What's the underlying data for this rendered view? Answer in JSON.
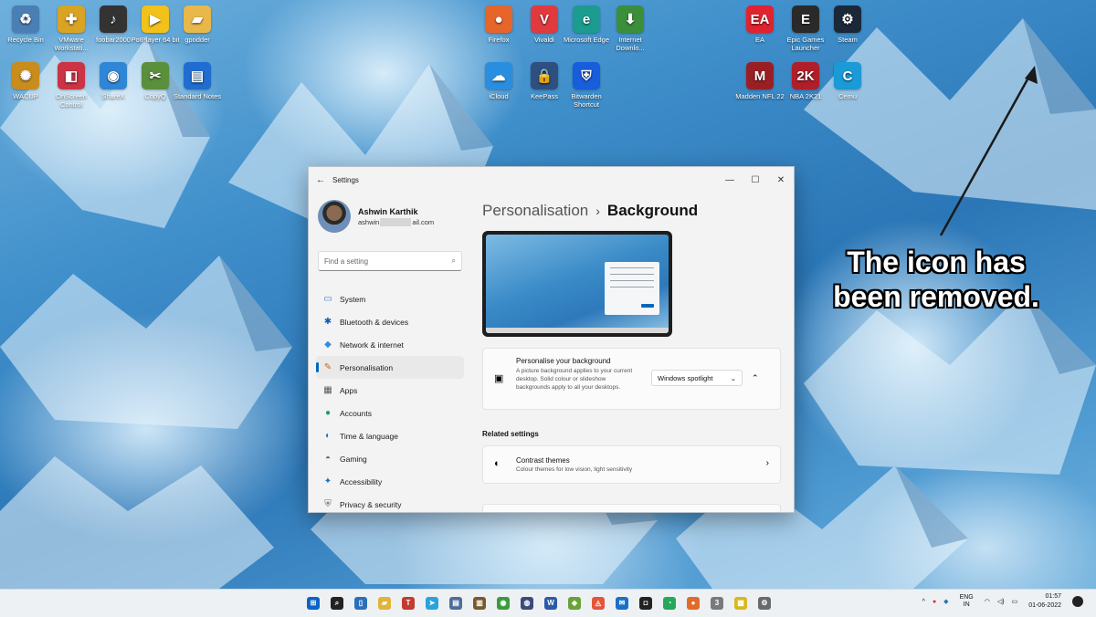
{
  "desktop": {
    "icons": [
      {
        "label": "Recycle Bin",
        "icon": "recycle-bin-icon",
        "color": "#4a7fb5",
        "glyph": "♻"
      },
      {
        "label": "VMware Workstati...",
        "icon": "vmware-icon",
        "color": "#d9a323",
        "glyph": "✚"
      },
      {
        "label": "foobar2000",
        "icon": "foobar-icon",
        "color": "#333333",
        "glyph": "♪"
      },
      {
        "label": "PotPlayer 64 bit",
        "icon": "potplayer-icon",
        "color": "#f2c21b",
        "glyph": "▶"
      },
      {
        "label": "gpodder",
        "icon": "folder-icon",
        "color": "#e8b84a",
        "glyph": "▰"
      },
      {
        "label": "WACUP",
        "icon": "wacup-icon",
        "color": "#c98d1d",
        "glyph": "✺"
      },
      {
        "label": "OnScreen Control",
        "icon": "onscreen-control-icon",
        "color": "#cc3344",
        "glyph": "◧"
      },
      {
        "label": "ShareX",
        "icon": "sharex-icon",
        "color": "#2f86d6",
        "glyph": "◉"
      },
      {
        "label": "CopyQ",
        "icon": "copyq-icon",
        "color": "#5a8f3c",
        "glyph": "✂"
      },
      {
        "label": "Standard Notes",
        "icon": "standard-notes-icon",
        "color": "#1f6dd0",
        "glyph": "▤"
      },
      {
        "label": "Firefox",
        "icon": "firefox-icon",
        "color": "#e5652b",
        "glyph": "●"
      },
      {
        "label": "Vivaldi",
        "icon": "vivaldi-icon",
        "color": "#e0393e",
        "glyph": "V"
      },
      {
        "label": "Microsoft Edge",
        "icon": "edge-icon",
        "color": "#1b9c8e",
        "glyph": "e"
      },
      {
        "label": "Internet Downlo...",
        "icon": "idm-icon",
        "color": "#3b8f3b",
        "glyph": "⬇"
      },
      {
        "label": "iCloud",
        "icon": "icloud-icon",
        "color": "#2a8ee0",
        "glyph": "☁"
      },
      {
        "label": "KeePass",
        "icon": "keepass-icon",
        "color": "#2f4f7f",
        "glyph": "🔒"
      },
      {
        "label": "Bitwarden Shortcut",
        "icon": "bitwarden-icon",
        "color": "#175ddc",
        "glyph": "⛨"
      },
      {
        "label": "EA",
        "icon": "ea-icon",
        "color": "#e0232f",
        "glyph": "EA"
      },
      {
        "label": "Epic Games Launcher",
        "icon": "epic-games-icon",
        "color": "#2a2a2a",
        "glyph": "E"
      },
      {
        "label": "Steam",
        "icon": "steam-icon",
        "color": "#1b2838",
        "glyph": "⚙"
      },
      {
        "label": "Madden NFL 22",
        "icon": "madden-icon",
        "color": "#9a1f24",
        "glyph": "M"
      },
      {
        "label": "NBA 2K21",
        "icon": "nba2k21-icon",
        "color": "#b01e2a",
        "glyph": "2K"
      },
      {
        "label": "Cemu",
        "icon": "cemu-icon",
        "color": "#1a9ad6",
        "glyph": "C"
      }
    ]
  },
  "annotation": {
    "line1": "The icon has",
    "line2": "been removed."
  },
  "window": {
    "title": "Settings",
    "back_glyph": "←",
    "minimize_glyph": "—",
    "maximize_glyph": "☐",
    "close_glyph": "✕",
    "profile": {
      "name": "Ashwin Karthik",
      "email_start": "ashwin",
      "email_end": "ail.com"
    },
    "search": {
      "placeholder": "Find a setting"
    },
    "nav": [
      {
        "label": "System",
        "icon": "system-icon",
        "glyph": "▭",
        "color": "#3b7fd1",
        "active": false
      },
      {
        "label": "Bluetooth & devices",
        "icon": "bluetooth-icon",
        "glyph": "✱",
        "color": "#0a5ec2",
        "active": false
      },
      {
        "label": "Network & internet",
        "icon": "network-icon",
        "glyph": "◆",
        "color": "#2d8fe0",
        "active": false
      },
      {
        "label": "Personalisation",
        "icon": "brush-icon",
        "glyph": "✎",
        "color": "#c56a1a",
        "active": true
      },
      {
        "label": "Apps",
        "icon": "apps-icon",
        "glyph": "▦",
        "color": "#555555",
        "active": false
      },
      {
        "label": "Accounts",
        "icon": "accounts-icon",
        "glyph": "●",
        "color": "#1f9c6b",
        "active": false
      },
      {
        "label": "Time & language",
        "icon": "time-language-icon",
        "glyph": "◐",
        "color": "#2277cc",
        "active": false
      },
      {
        "label": "Gaming",
        "icon": "gaming-icon",
        "glyph": "◓",
        "color": "#666666",
        "active": false
      },
      {
        "label": "Accessibility",
        "icon": "accessibility-icon",
        "glyph": "✦",
        "color": "#1a6fc4",
        "active": false
      },
      {
        "label": "Privacy & security",
        "icon": "shield-icon",
        "glyph": "⛨",
        "color": "#666666",
        "active": false
      }
    ],
    "breadcrumb": {
      "parent": "Personalisation",
      "separator": "›",
      "current": "Background"
    },
    "background_card": {
      "title": "Personalise your background",
      "description": "A picture background applies to your current desktop. Solid colour or slideshow backgrounds apply to all your desktops.",
      "dropdown_value": "Windows spotlight",
      "expand_glyph": "⌃"
    },
    "related_heading": "Related settings",
    "contrast_card": {
      "title": "Contrast themes",
      "description": "Colour themes for low vision, light sensitivity"
    }
  },
  "taskbar": {
    "apps": [
      {
        "icon": "start-icon",
        "glyph": "⊞",
        "color": "#0a64c8"
      },
      {
        "icon": "search-icon",
        "glyph": "⌕",
        "color": "#222222"
      },
      {
        "icon": "phone-icon",
        "glyph": "▯",
        "color": "#2b6fb8"
      },
      {
        "icon": "file-explorer-icon",
        "glyph": "▰",
        "color": "#e2b33a"
      },
      {
        "icon": "app-t-icon",
        "glyph": "T",
        "color": "#c33a2f"
      },
      {
        "icon": "telegram-icon",
        "glyph": "➤",
        "color": "#2aa3dc"
      },
      {
        "icon": "calendar-icon",
        "glyph": "▤",
        "color": "#4d6e9a"
      },
      {
        "icon": "book-icon",
        "glyph": "▥",
        "color": "#7a5a2c"
      },
      {
        "icon": "chrome-icon",
        "glyph": "◉",
        "color": "#3a9b3e"
      },
      {
        "icon": "lock-app-icon",
        "glyph": "◍",
        "color": "#3b4b7a"
      },
      {
        "icon": "word-icon",
        "glyph": "W",
        "color": "#2b5aa8"
      },
      {
        "icon": "rss-icon",
        "glyph": "◈",
        "color": "#6aa23a"
      },
      {
        "icon": "brave-icon",
        "glyph": "◬",
        "color": "#e2563a"
      },
      {
        "icon": "mail-icon",
        "glyph": "✉",
        "color": "#1a70c7"
      },
      {
        "icon": "store-icon",
        "glyph": "◘",
        "color": "#222222"
      },
      {
        "icon": "whatsapp-icon",
        "glyph": "◔",
        "color": "#25a85a"
      },
      {
        "icon": "firefox-taskbar-icon",
        "glyph": "●",
        "color": "#e06b2a"
      },
      {
        "icon": "notes-icon",
        "glyph": "3",
        "color": "#7a7a7a"
      },
      {
        "icon": "sticky-icon",
        "glyph": "▩",
        "color": "#d9b81e"
      },
      {
        "icon": "settings-gear-icon",
        "glyph": "⚙",
        "color": "#6a6a6a"
      }
    ],
    "tray": {
      "chevron": "^",
      "lang_top": "ENG",
      "lang_bottom": "IN",
      "time": "01:57",
      "date": "01-06-2022"
    }
  }
}
